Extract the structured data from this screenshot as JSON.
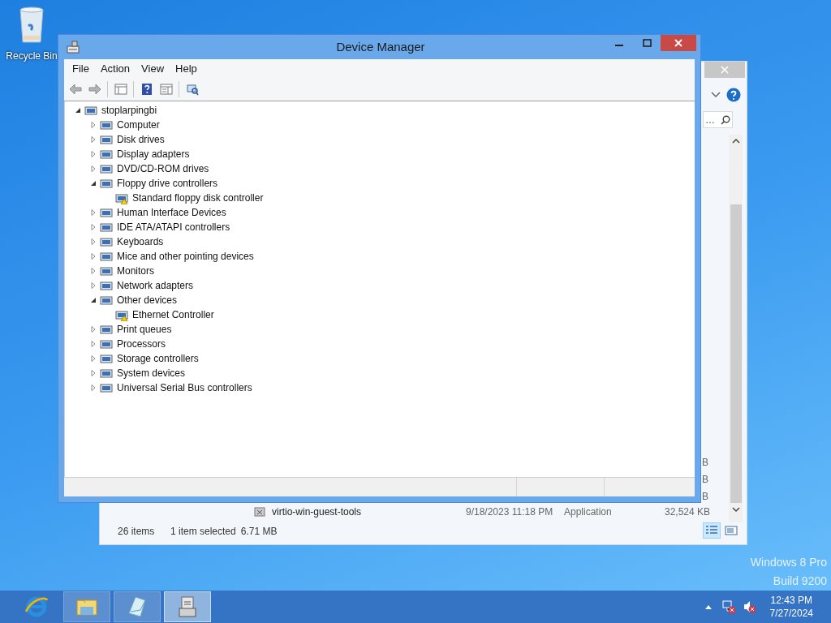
{
  "desktop": {
    "icons": [
      {
        "label": "Recycle Bin"
      }
    ],
    "watermark": [
      "Windows 8 Pro",
      "Build 9200"
    ]
  },
  "background_window": {
    "search_text": "…",
    "cut_sizes": [
      "B",
      "B",
      "B"
    ],
    "rows": [
      {
        "name": "virtio-win-guest-tools",
        "date": "9/18/2023 11:18 PM",
        "type": "Application",
        "size": "32,524 KB"
      }
    ],
    "status": {
      "items": "26 items",
      "selection": "1 item selected",
      "selection_size": "6.71 MB"
    },
    "views": [
      {
        "selected": true
      },
      {
        "selected": false
      }
    ]
  },
  "window": {
    "title": "Device Manager",
    "menu": [
      "File",
      "Action",
      "View",
      "Help"
    ],
    "tree": {
      "label": "stoplarpingbi",
      "expanded": true,
      "children": [
        {
          "label": "Computer",
          "expanded": false
        },
        {
          "label": "Disk drives",
          "expanded": false
        },
        {
          "label": "Display adapters",
          "expanded": false
        },
        {
          "label": "DVD/CD-ROM drives",
          "expanded": false
        },
        {
          "label": "Floppy drive controllers",
          "expanded": true,
          "children": [
            {
              "label": "Standard floppy disk controller",
              "warning": true
            }
          ]
        },
        {
          "label": "Human Interface Devices",
          "expanded": false
        },
        {
          "label": "IDE ATA/ATAPI controllers",
          "expanded": false
        },
        {
          "label": "Keyboards",
          "expanded": false
        },
        {
          "label": "Mice and other pointing devices",
          "expanded": false
        },
        {
          "label": "Monitors",
          "expanded": false
        },
        {
          "label": "Network adapters",
          "expanded": false
        },
        {
          "label": "Other devices",
          "expanded": true,
          "children": [
            {
              "label": "Ethernet Controller",
              "warning": true
            }
          ]
        },
        {
          "label": "Print queues",
          "expanded": false
        },
        {
          "label": "Processors",
          "expanded": false
        },
        {
          "label": "Storage controllers",
          "expanded": false
        },
        {
          "label": "System devices",
          "expanded": false
        },
        {
          "label": "Universal Serial Bus controllers",
          "expanded": false
        }
      ]
    }
  },
  "taskbar": {
    "items": [
      {
        "selected": false
      },
      {
        "selected": false
      },
      {
        "selected": false
      },
      {
        "selected": true
      }
    ],
    "clock": {
      "time": "12:43 PM",
      "date": "7/27/2024"
    }
  }
}
